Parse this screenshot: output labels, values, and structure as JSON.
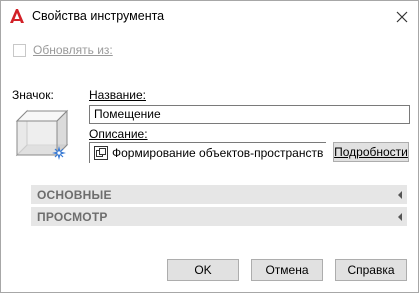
{
  "window": {
    "title": "Свойства инструмента",
    "logo_icon": "autocad-a-icon",
    "close_icon": "close-icon"
  },
  "update_from": {
    "label": "Обновлять из:",
    "checked": false,
    "enabled": false
  },
  "image": {
    "label": "Значок:",
    "icon": "space-box-icon"
  },
  "name": {
    "label": "Название:",
    "value": "Помещение"
  },
  "description": {
    "label": "Описание:",
    "value": "Формирование объектов-пространств",
    "details_button": "Подробности"
  },
  "sections": [
    {
      "title": "ОСНОВНЫЕ",
      "expanded": false
    },
    {
      "title": "ПРОСМОТР",
      "expanded": false
    }
  ],
  "buttons": {
    "ok": "OK",
    "cancel": "Отмена",
    "help": "Справка"
  },
  "colors": {
    "logo_red": "#d22027",
    "section_bg": "#e6e6e6",
    "section_text": "#6d6d6d",
    "button_bg": "#e1e1e1"
  }
}
